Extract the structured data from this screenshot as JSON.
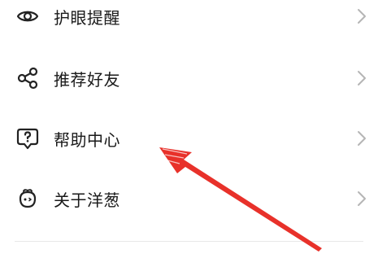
{
  "menu": {
    "items": [
      {
        "label": "护眼提醒",
        "icon": "eye-icon"
      },
      {
        "label": "推荐好友",
        "icon": "share-icon"
      },
      {
        "label": "帮助中心",
        "icon": "help-question-icon"
      },
      {
        "label": "关于洋葱",
        "icon": "onion-mascot-icon"
      }
    ]
  },
  "colors": {
    "text": "#1a1a1a",
    "icon": "#222222",
    "chevron": "#b5b5b5",
    "divider": "#e8e8e8",
    "annotation_arrow": "#e8312a"
  }
}
